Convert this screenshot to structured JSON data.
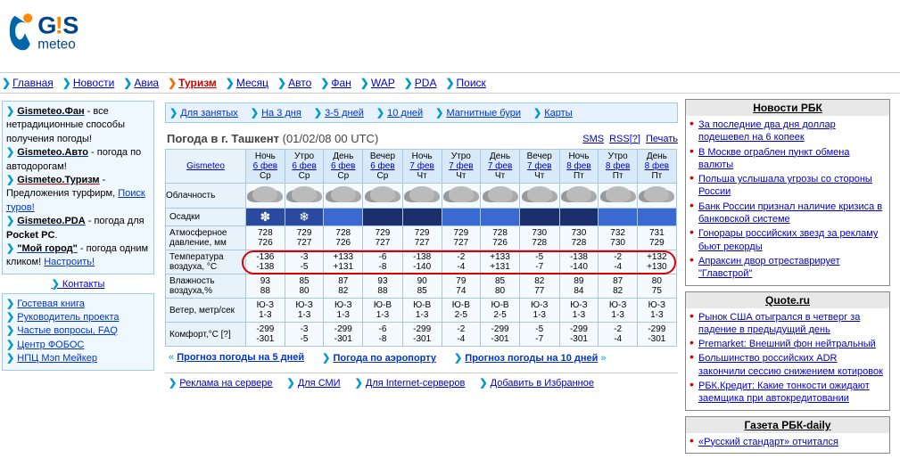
{
  "logo": {
    "brand": "G!Smeteo"
  },
  "topnav": [
    {
      "label": "Главная"
    },
    {
      "label": "Новости"
    },
    {
      "label": "Авиа"
    },
    {
      "label": "Туризм",
      "active": true
    },
    {
      "label": "Месяц"
    },
    {
      "label": "Авто"
    },
    {
      "label": "Фан"
    },
    {
      "label": "WAP"
    },
    {
      "label": "PDA"
    },
    {
      "label": "Поиск"
    }
  ],
  "leftbox": {
    "items": [
      {
        "link": "Gismeteo.Фан",
        "text": " - все нетрадиционные способы получения погоды!"
      },
      {
        "link": "Gismeteo.Авто",
        "text": " - погода по автодорогам!"
      },
      {
        "link": "Gismeteo.Туризм",
        "red": true,
        "text": " - Предложения турфирм, ",
        "tail": "Поиск туров!"
      },
      {
        "link": "Gismeteo.PDA",
        "text": " - погода для ",
        "bold": "Pocket PC",
        "post": "."
      },
      {
        "link": "\"Мой город\"",
        "text": " - погода одним кликом! ",
        "tail": "Настроить!"
      }
    ]
  },
  "leftlinks": {
    "contacts": "Контакты",
    "items": [
      "Гостевая книга",
      "Руководитель проекта",
      "Частые вопросы, FAQ",
      "Центр ФОБОС",
      "НПЦ Мэп Мейкер"
    ]
  },
  "subnav": [
    "Для занятых",
    "На 3 дня",
    "3-5 дней",
    "10 дней",
    "Магнитные бури",
    "Карты"
  ],
  "title": {
    "prefix": "Погода в г. ",
    "city": "Ташкент",
    "dt": "(01/02/08 00 UTC)",
    "links": [
      "SMS",
      "RSS[?]",
      "Печать"
    ]
  },
  "table": {
    "corner": "Gismeteo",
    "cols": [
      {
        "part": "Ночь",
        "date": "6 фев",
        "dow": "Ср"
      },
      {
        "part": "Утро",
        "date": "6 фев",
        "dow": "Ср"
      },
      {
        "part": "День",
        "date": "6 фев",
        "dow": "Ср"
      },
      {
        "part": "Вечер",
        "date": "6 фев",
        "dow": "Ср"
      },
      {
        "part": "Ночь",
        "date": "7 фев",
        "dow": "Чт"
      },
      {
        "part": "Утро",
        "date": "7 фев",
        "dow": "Чт"
      },
      {
        "part": "День",
        "date": "7 фев",
        "dow": "Чт"
      },
      {
        "part": "Вечер",
        "date": "7 фев",
        "dow": "Чт"
      },
      {
        "part": "Ночь",
        "date": "8 фев",
        "dow": "Пт"
      },
      {
        "part": "Утро",
        "date": "8 фев",
        "dow": "Пт"
      },
      {
        "part": "День",
        "date": "8 фев",
        "dow": "Пт"
      }
    ],
    "rows": [
      {
        "h": "Облачность",
        "type": "cloud"
      },
      {
        "h": "Осадки",
        "type": "precip",
        "v": [
          "snow",
          "snow-big",
          "day",
          "night",
          "night",
          "day",
          "day",
          "night",
          "night",
          "day",
          "day"
        ]
      },
      {
        "h": "Атмосферное давление, мм",
        "type": "dual",
        "v": [
          [
            "728",
            "726"
          ],
          [
            "729",
            "727"
          ],
          [
            "728",
            "726"
          ],
          [
            "729",
            "727"
          ],
          [
            "729",
            "727"
          ],
          [
            "729",
            "727"
          ],
          [
            "728",
            "726"
          ],
          [
            "730",
            "728"
          ],
          [
            "730",
            "728"
          ],
          [
            "732",
            "730"
          ],
          [
            "731",
            "729"
          ]
        ]
      },
      {
        "h": "Температура воздуха, °С",
        "type": "dual",
        "circled": true,
        "v": [
          [
            "-136",
            "-138"
          ],
          [
            "-3",
            "-5"
          ],
          [
            "+133",
            "+131"
          ],
          [
            "-6",
            "-8"
          ],
          [
            "-138",
            "-140"
          ],
          [
            "-2",
            "-4"
          ],
          [
            "+133",
            "+131"
          ],
          [
            "-5",
            "-7"
          ],
          [
            "-138",
            "-140"
          ],
          [
            "-2",
            "-4"
          ],
          [
            "+132",
            "+130"
          ]
        ]
      },
      {
        "h": "Влажность воздуха,%",
        "type": "dual",
        "v": [
          [
            "93",
            "88"
          ],
          [
            "85",
            "80"
          ],
          [
            "87",
            "82"
          ],
          [
            "93",
            "88"
          ],
          [
            "90",
            "85"
          ],
          [
            "79",
            "74"
          ],
          [
            "85",
            "80"
          ],
          [
            "82",
            "77"
          ],
          [
            "89",
            "84"
          ],
          [
            "87",
            "82"
          ],
          [
            "80",
            "75"
          ]
        ]
      },
      {
        "h": "Ветер, метр/сек",
        "type": "dual",
        "v": [
          [
            "Ю-З",
            "1-3"
          ],
          [
            "Ю-З",
            "1-3"
          ],
          [
            "Ю-З",
            "1-3"
          ],
          [
            "Ю-В",
            "1-3"
          ],
          [
            "Ю-В",
            "1-3"
          ],
          [
            "Ю-В",
            "2-5"
          ],
          [
            "Ю-В",
            "2-5"
          ],
          [
            "Ю-З",
            "1-3"
          ],
          [
            "Ю-З",
            "1-3"
          ],
          [
            "Ю-З",
            "1-3"
          ],
          [
            "Ю-З",
            "1-3"
          ]
        ]
      },
      {
        "h": "Комфорт,°С [?]",
        "type": "dual",
        "v": [
          [
            "-299",
            "-301"
          ],
          [
            "-3",
            "-5"
          ],
          [
            "-299",
            "-301"
          ],
          [
            "-6",
            "-8"
          ],
          [
            "-299",
            "-301"
          ],
          [
            "-2",
            "-4"
          ],
          [
            "-299",
            "-301"
          ],
          [
            "-5",
            "-7"
          ],
          [
            "-299",
            "-301"
          ],
          [
            "-2",
            "-4"
          ],
          [
            "-299",
            "-301"
          ]
        ]
      }
    ]
  },
  "bottomlinks": [
    "Прогноз погоды на 5 дней",
    "Погода по аэропорту",
    "Прогноз погоды на 10 дней"
  ],
  "footer": [
    "Реклама на сервере",
    "Для СМИ",
    "Для Internet-серверов",
    "Добавить в Избранное"
  ],
  "rbk": {
    "title": "Новости РБК",
    "items": [
      "За последние два дня доллар подешевел на 6 копеек",
      "В Москве ограблен пункт обмена валюты",
      "Польша услышала угрозы со стороны России",
      "Банк России признал наличие кризиса в банковской системе",
      "Гонорары российских звезд за рекламу бьют рекорды",
      "Апраксин двор отреставрирует \"Главстрой\""
    ]
  },
  "quote": {
    "title": "Quote.ru",
    "items": [
      "Рынок США отыгрался в четверг за падение в предыдущий день",
      "Premarket: Внешний фон нейтральный",
      "Большинство российских ADR закончили сессию снижением котировок",
      "РБК.Кредит: Какие тонкости ожидают заемщика при автокредитовании"
    ]
  },
  "daily": {
    "title": "Газета РБК-daily",
    "items": [
      "«Русский стандарт» отчитался"
    ]
  }
}
